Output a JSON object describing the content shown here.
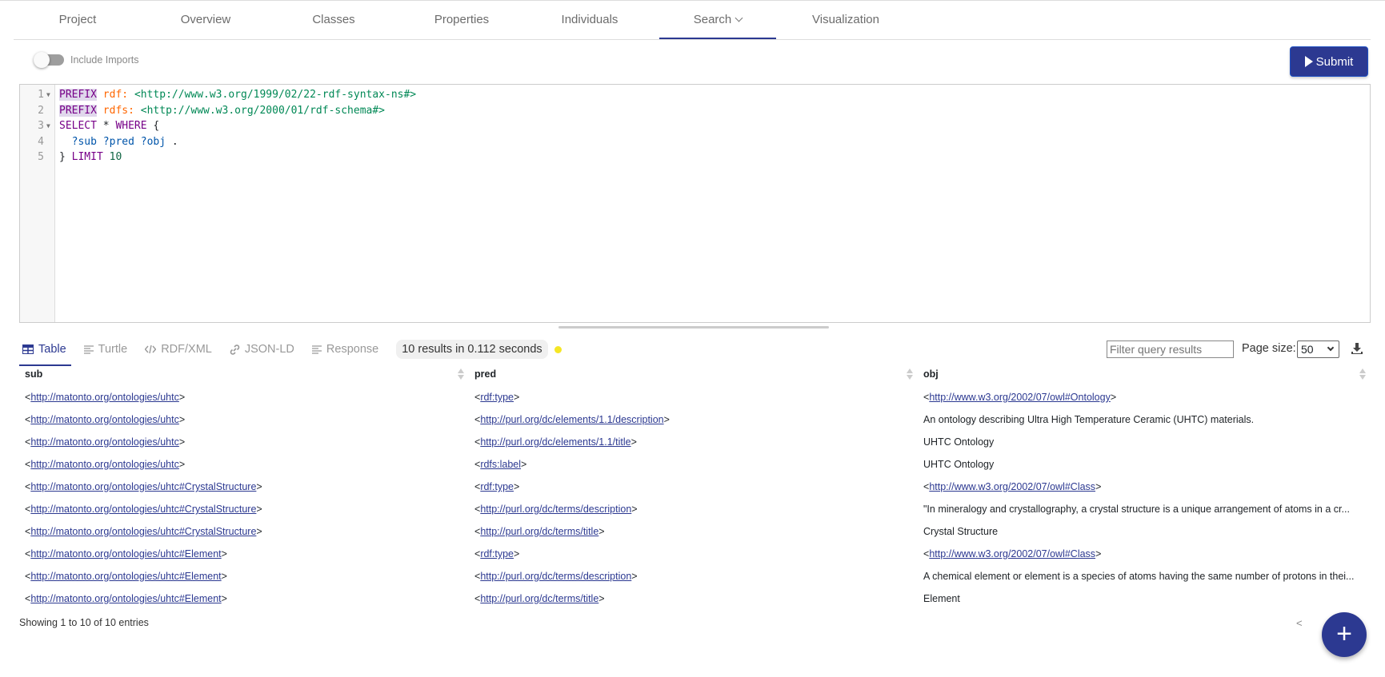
{
  "nav": {
    "items": [
      {
        "label": "Project"
      },
      {
        "label": "Overview"
      },
      {
        "label": "Classes"
      },
      {
        "label": "Properties"
      },
      {
        "label": "Individuals"
      },
      {
        "label": "Search",
        "active": true,
        "has_dropdown": true
      },
      {
        "label": "Visualization"
      }
    ]
  },
  "toolbar": {
    "include_imports_label": "Include Imports",
    "include_imports_on": false,
    "submit_label": "Submit"
  },
  "editor": {
    "lines": [
      {
        "n": "1",
        "fold": true,
        "tokens": [
          [
            "PREFIX",
            "kw pfx"
          ],
          [
            " ",
            ""
          ],
          [
            "rdf:",
            "pn"
          ],
          [
            " ",
            ""
          ],
          [
            "<http://www.w3.org/1999/02/22-rdf-syntax-ns#>",
            "iri"
          ]
        ]
      },
      {
        "n": "2",
        "fold": false,
        "tokens": [
          [
            "PREFIX",
            "kw pfx"
          ],
          [
            " ",
            ""
          ],
          [
            "rdfs:",
            "pn"
          ],
          [
            " ",
            ""
          ],
          [
            "<http://www.w3.org/2000/01/rdf-schema#>",
            "iri"
          ]
        ]
      },
      {
        "n": "3",
        "fold": true,
        "tokens": [
          [
            "SELECT",
            "kw"
          ],
          [
            " * ",
            ""
          ],
          [
            "WHERE",
            "kw"
          ],
          [
            " {",
            ""
          ]
        ]
      },
      {
        "n": "4",
        "fold": false,
        "tokens": [
          [
            "  ",
            ""
          ],
          [
            "?sub",
            "var"
          ],
          [
            " ",
            ""
          ],
          [
            "?pred",
            "var"
          ],
          [
            " ",
            ""
          ],
          [
            "?obj",
            "var"
          ],
          [
            " .",
            ""
          ]
        ]
      },
      {
        "n": "5",
        "fold": false,
        "tokens": [
          [
            "} ",
            ""
          ],
          [
            "LIMIT",
            "kw"
          ],
          [
            " ",
            ""
          ],
          [
            "10",
            "num"
          ]
        ]
      }
    ]
  },
  "results": {
    "tabs": [
      {
        "label": "Table",
        "icon": "table-icon",
        "active": true
      },
      {
        "label": "Turtle",
        "icon": "lines-icon"
      },
      {
        "label": "RDF/XML",
        "icon": "code-icon"
      },
      {
        "label": "JSON-LD",
        "icon": "link-icon"
      },
      {
        "label": "Response",
        "icon": "lines-icon"
      }
    ],
    "summary": "10 results in 0.112 seconds",
    "status_color": "#f5e625",
    "filter_placeholder": "Filter query results",
    "page_size_label": "Page size:",
    "page_size": "50",
    "columns": [
      "sub",
      "pred",
      "obj"
    ],
    "rows": [
      [
        {
          "iri": "http://matonto.org/ontologies/uhtc"
        },
        {
          "iri": "rdf:type"
        },
        {
          "iri": "http://www.w3.org/2002/07/owl#Ontology"
        }
      ],
      [
        {
          "iri": "http://matonto.org/ontologies/uhtc"
        },
        {
          "iri": "http://purl.org/dc/elements/1.1/description"
        },
        {
          "text": "An ontology describing Ultra High Temperature Ceramic (UHTC) materials."
        }
      ],
      [
        {
          "iri": "http://matonto.org/ontologies/uhtc"
        },
        {
          "iri": "http://purl.org/dc/elements/1.1/title"
        },
        {
          "text": "UHTC Ontology"
        }
      ],
      [
        {
          "iri": "http://matonto.org/ontologies/uhtc"
        },
        {
          "iri": "rdfs:label"
        },
        {
          "text": "UHTC Ontology"
        }
      ],
      [
        {
          "iri": "http://matonto.org/ontologies/uhtc#CrystalStructure"
        },
        {
          "iri": "rdf:type"
        },
        {
          "iri": "http://www.w3.org/2002/07/owl#Class"
        }
      ],
      [
        {
          "iri": "http://matonto.org/ontologies/uhtc#CrystalStructure"
        },
        {
          "iri": "http://purl.org/dc/terms/description"
        },
        {
          "text": "\"In mineralogy and crystallography, a crystal structure is a unique arrangement of atoms in a cr..."
        }
      ],
      [
        {
          "iri": "http://matonto.org/ontologies/uhtc#CrystalStructure"
        },
        {
          "iri": "http://purl.org/dc/terms/title"
        },
        {
          "text": "Crystal Structure"
        }
      ],
      [
        {
          "iri": "http://matonto.org/ontologies/uhtc#Element"
        },
        {
          "iri": "rdf:type"
        },
        {
          "iri": "http://www.w3.org/2002/07/owl#Class"
        }
      ],
      [
        {
          "iri": "http://matonto.org/ontologies/uhtc#Element"
        },
        {
          "iri": "http://purl.org/dc/terms/description"
        },
        {
          "text": "A chemical element or element is a species of atoms having the same number of protons in thei..."
        }
      ],
      [
        {
          "iri": "http://matonto.org/ontologies/uhtc#Element"
        },
        {
          "iri": "http://purl.org/dc/terms/title"
        },
        {
          "text": "Element"
        }
      ]
    ],
    "footer": "Showing 1 to 10 of 10 entries",
    "prev_label": "<"
  },
  "fab_label": "+",
  "accent": "#2c3991"
}
